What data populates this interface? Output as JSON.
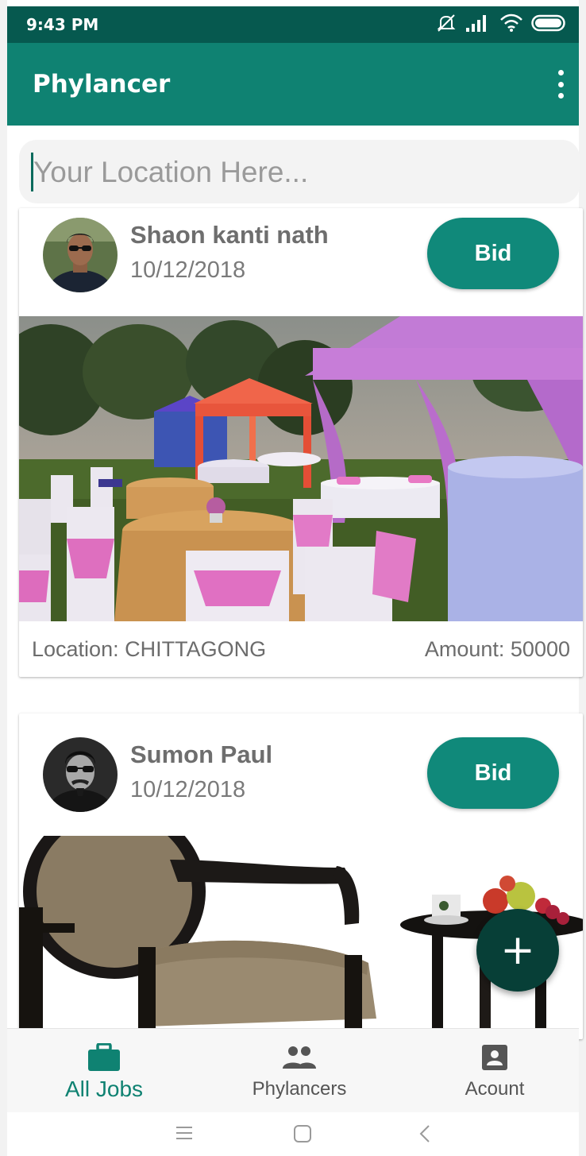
{
  "status_bar": {
    "time": "9:43 PM"
  },
  "app_bar": {
    "title": "Phylancer"
  },
  "search": {
    "placeholder": "Your Location Here..."
  },
  "jobs": [
    {
      "poster_name": "Shaon kanti nath",
      "date": "10/12/2018",
      "bid_label": "Bid",
      "location_text": "Location: CHITTAGONG",
      "amount_text": "Amount: 50000"
    },
    {
      "poster_name": "Sumon Paul",
      "date": "10/12/2018",
      "bid_label": "Bid"
    }
  ],
  "fab": {
    "label": "+"
  },
  "bottom_nav": {
    "items": [
      {
        "label": "All Jobs",
        "icon": "briefcase-icon",
        "active": true
      },
      {
        "label": "Phylancers",
        "icon": "people-icon",
        "active": false
      },
      {
        "label": "Acount",
        "icon": "account-box-icon",
        "active": false
      }
    ]
  },
  "colors": {
    "primary": "#0f8272",
    "primary_dark": "#06594f",
    "fab": "#073f37",
    "bid_button": "#10897a"
  }
}
